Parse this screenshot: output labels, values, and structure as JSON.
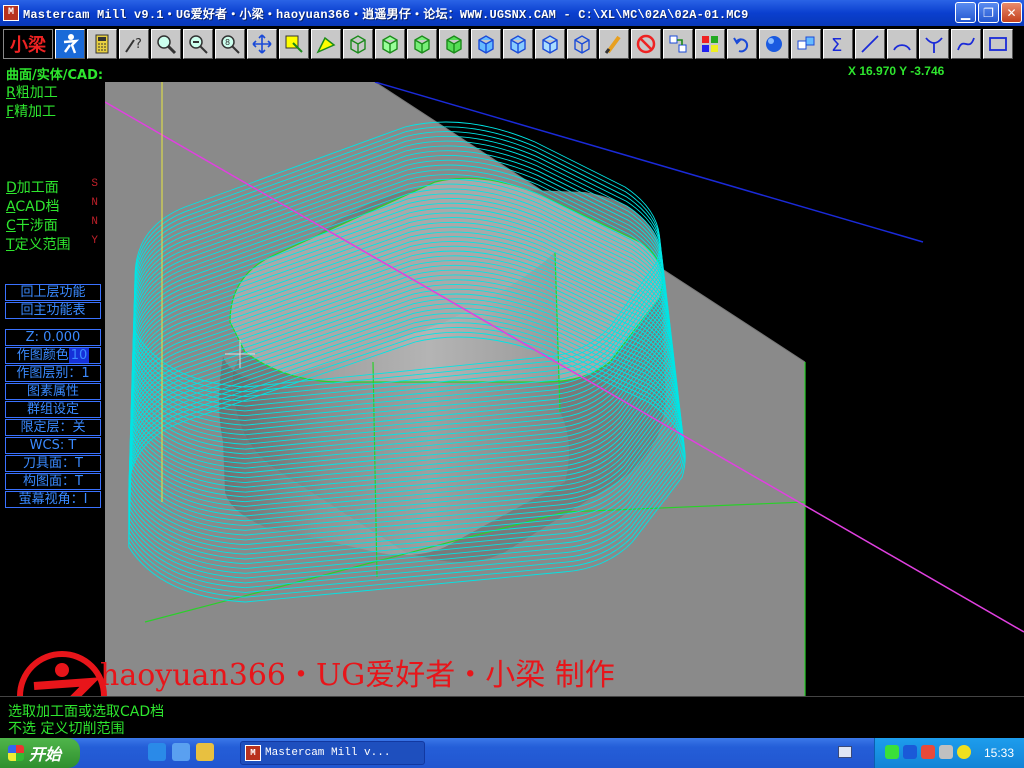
{
  "window": {
    "icon_label": "M",
    "title": "Mastercam Mill v9.1・UG爱好者・小梁・haoyuan366・逍遥男仔・论坛：WWW.UGSNX.CAM - C:\\XL\\MC\\02A\\02A-01.MC9",
    "controls": [
      "minimize",
      "maximize",
      "close"
    ]
  },
  "toolbar": {
    "brand_label": "小梁",
    "icons": [
      "runner-icon",
      "calculator-icon",
      "analyze-icon",
      "zoom-window-icon",
      "unzoom-icon",
      "zoom-8-icon",
      "pan-icon",
      "select-icon",
      "chain-icon",
      "cube-top-icon",
      "cube-front-icon",
      "cube-side-icon",
      "cube-iso-icon",
      "cube-shaded-icon",
      "cube-blue-1-icon",
      "cube-blue-2-icon",
      "cube-blue-3-icon",
      "paintbrush-icon",
      "no-entry-icon",
      "layer-arrow-icon",
      "layer-color-icon",
      "undo-icon",
      "sphere-icon",
      "group-icon",
      "sigma-icon",
      "line-icon",
      "arc-icon",
      "curve-icon",
      "spline-icon",
      "rectangle-icon"
    ]
  },
  "coords": {
    "text": "X 16.970  Y -3.746"
  },
  "menu": {
    "header": "曲面/实体/CAD:",
    "items": [
      {
        "key": "R",
        "label": "粗加工",
        "flag": ""
      },
      {
        "key": "F",
        "label": "精加工",
        "flag": ""
      },
      {
        "key": "D",
        "label": "加工面",
        "flag": "S"
      },
      {
        "key": "A",
        "label": "CAD档",
        "flag": "N"
      },
      {
        "key": "C",
        "label": "干涉面",
        "flag": "N"
      },
      {
        "key": "T",
        "label": "定义范围",
        "flag": "Y"
      }
    ],
    "nav_buttons": [
      "回上层功能",
      "回主功能表"
    ],
    "status_buttons": [
      {
        "label": "Z:  0.000"
      },
      {
        "label": "作图颜色",
        "tag": "10"
      },
      {
        "label": "作图层别：1"
      },
      {
        "label": "图素属性"
      },
      {
        "label": "群组设定"
      },
      {
        "label": "限定层：关"
      },
      {
        "label": "WCS:  T"
      },
      {
        "label": "刀具面：T"
      },
      {
        "label": "构图面：T"
      },
      {
        "label": "萤幕视角：I"
      }
    ]
  },
  "watermark": {
    "text": "haoyuan366・UG爱好者・小梁 制作",
    "logo_text": "UG爱好者",
    "logo_url": "WWW.UGSNX.COM"
  },
  "prompt": {
    "line1": "选取加工面或选取CAD档",
    "line2": "不选 定义切削范围"
  },
  "taskbar": {
    "start_label": "开始",
    "task_item": "Mastercam Mill v...",
    "clock": "15:33"
  },
  "colors": {
    "toolpath": "#00e5e5",
    "menu_text": "#2ee62e",
    "status_button": "#3a72ff",
    "watermark": "#e8151a",
    "axis_magenta": "#e040e0",
    "axis_blue": "#1a2ad8"
  }
}
